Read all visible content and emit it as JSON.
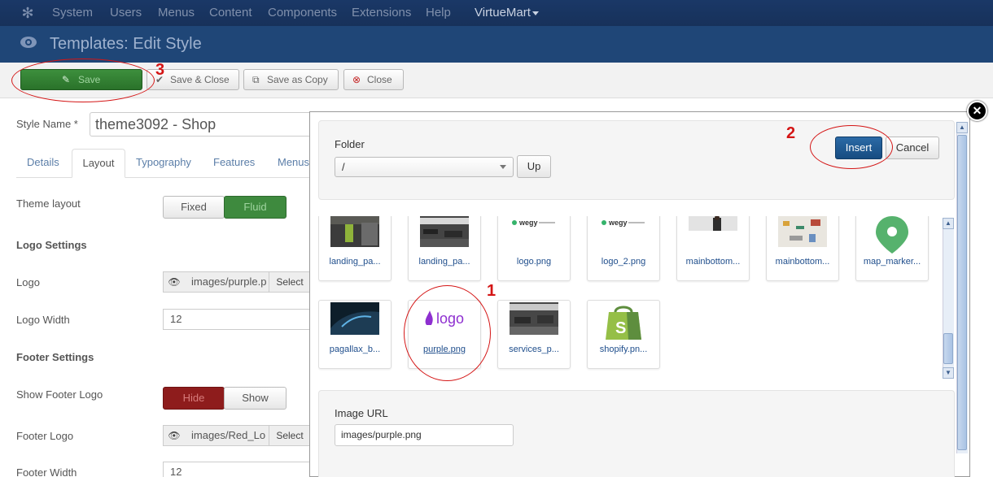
{
  "topnav": {
    "items": [
      "System",
      "Users",
      "Menus",
      "Content",
      "Components",
      "Extensions",
      "Help"
    ],
    "virtuemart": "VirtueMart"
  },
  "header": {
    "title": "Templates: Edit Style"
  },
  "toolbar": {
    "save": "Save",
    "save_close": "Save & Close",
    "save_copy": "Save as Copy",
    "close": "Close"
  },
  "form": {
    "style_name_label": "Style Name *",
    "style_name_value": "theme3092 - Shop",
    "tabs": [
      "Details",
      "Layout",
      "Typography",
      "Features",
      "Menus"
    ],
    "active_tab": "Layout",
    "theme_layout_label": "Theme layout",
    "theme_layout_options": [
      "Fixed",
      "Fluid"
    ],
    "theme_layout_selected": "Fluid",
    "logo_settings_heading": "Logo Settings",
    "logo_label": "Logo",
    "logo_value": "images/purple.p",
    "select_label": "Select",
    "logo_width_label": "Logo Width",
    "logo_width_value": "12",
    "footer_settings_heading": "Footer Settings",
    "show_footer_logo_label": "Show Footer Logo",
    "show_footer_logo_options": [
      "Hide",
      "Show"
    ],
    "show_footer_logo_selected": "Hide",
    "footer_logo_label": "Footer Logo",
    "footer_logo_value": "images/Red_Lo",
    "footer_width_label": "Footer Width",
    "footer_width_value": "12"
  },
  "modal": {
    "folder_label": "Folder",
    "folder_value": "/",
    "up_button": "Up",
    "insert_button": "Insert",
    "cancel_button": "Cancel",
    "images": [
      {
        "name": "landing_pa...",
        "kind": "photo-dark"
      },
      {
        "name": "landing_pa...",
        "kind": "photo-office"
      },
      {
        "name": "logo.png",
        "kind": "logo-wegy"
      },
      {
        "name": "logo_2.png",
        "kind": "logo-wegy"
      },
      {
        "name": "mainbottom...",
        "kind": "photo-person"
      },
      {
        "name": "mainbottom...",
        "kind": "photo-desk"
      },
      {
        "name": "map_marker...",
        "kind": "map-marker"
      },
      {
        "name": "pagallax_b...",
        "kind": "photo-night"
      },
      {
        "name": "purple.png",
        "kind": "logo-purple",
        "selected": true
      },
      {
        "name": "services_p...",
        "kind": "photo-office"
      },
      {
        "name": "shopify.pn...",
        "kind": "shopify-bag"
      }
    ],
    "wegy_text": "wegy",
    "purple_logo_text": "logo",
    "image_url_label": "Image URL",
    "image_url_value": "images/purple.png"
  },
  "annotations": {
    "n1": "1",
    "n2": "2",
    "n3": "3"
  },
  "colors": {
    "nav_bg": "#1a3867",
    "header_bg": "#1f4677",
    "save_green": "#2f7f2f",
    "insert_blue": "#1d5a96",
    "annotation_red": "#d41515"
  }
}
